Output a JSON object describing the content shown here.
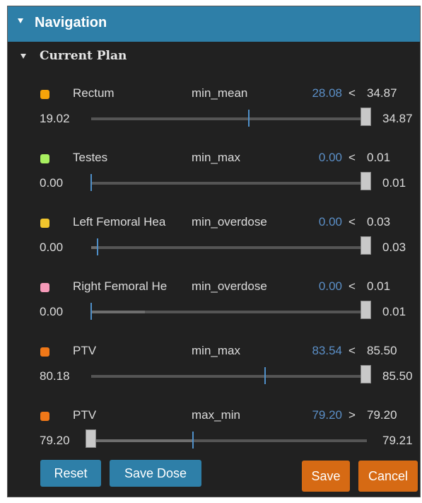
{
  "header": {
    "title": "Navigation"
  },
  "section": {
    "title": "Current Plan"
  },
  "constraints": [
    {
      "label": "Rectum",
      "type": "min_mean",
      "current": "28.08",
      "op": "<",
      "limit": "34.87",
      "min": "19.02",
      "max": "34.87",
      "color": "#f5a40a"
    },
    {
      "label": "Testes",
      "type": "min_max",
      "current": "0.00",
      "op": "<",
      "limit": "0.01",
      "min": "0.00",
      "max": "0.01",
      "color": "#a8f060"
    },
    {
      "label": "Left Femoral Hea",
      "type": "min_overdose",
      "current": "0.00",
      "op": "<",
      "limit": "0.03",
      "min": "0.00",
      "max": "0.03",
      "color": "#f0c52d"
    },
    {
      "label": "Right Femoral He",
      "type": "min_overdose",
      "current": "0.00",
      "op": "<",
      "limit": "0.01",
      "min": "0.00",
      "max": "0.01",
      "color": "#f59ab8"
    },
    {
      "label": "PTV",
      "type": "min_max",
      "current": "83.54",
      "op": "<",
      "limit": "85.50",
      "min": "80.18",
      "max": "85.50",
      "color": "#f07818"
    },
    {
      "label": "PTV",
      "type": "max_min",
      "current": "79.20",
      "op": ">",
      "limit": "79.20",
      "min": "79.20",
      "max": "79.21",
      "color": "#f07818"
    }
  ],
  "buttons": {
    "reset": "Reset",
    "save_dose": "Save Dose",
    "save": "Save",
    "cancel": "Cancel"
  }
}
